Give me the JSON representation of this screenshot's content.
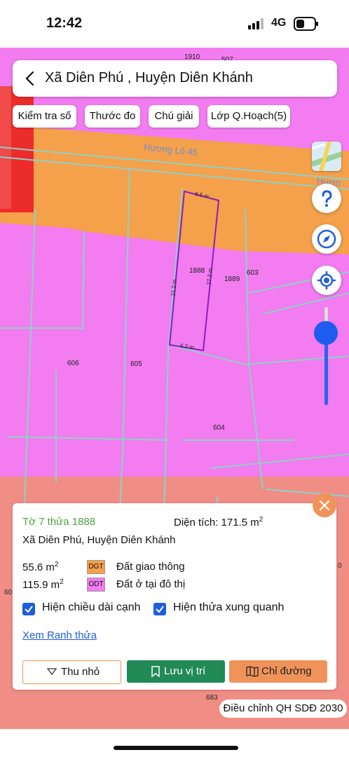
{
  "status_bar": {
    "time": "12:42",
    "network": "4G"
  },
  "header": {
    "title": "Xã Diên Phú , Huyện Diên Khánh"
  },
  "toolbar": {
    "check_number": "Kiểm tra số",
    "ruler": "Thước đo",
    "legend": "Chú giải",
    "planning_layer": "Lớp Q.Hoạch(5)"
  },
  "map": {
    "road_name": "Hương Lộ 45",
    "road_name_right": "Hươn",
    "parcel_labels": [
      "1910",
      "507",
      "1888",
      "1889",
      "603",
      "606",
      "605",
      "604",
      "683",
      "60",
      "0"
    ],
    "dimensions": [
      "6.5 m",
      "27.2 m",
      "21.2 m",
      "6.2 m"
    ],
    "colors": {
      "residential": "#f27cf0",
      "traffic": "#f5a04a",
      "red_zone": "#ee2222",
      "selection": "#8a1fbf",
      "grid_line": "#8fd0c8"
    }
  },
  "panel": {
    "parcel_id": "Tờ 7 thửa 1888",
    "area_label": "Diện tích: 171.5 m",
    "area_sup": "2",
    "location": "Xã Diên Phú, Huyện Diên Khánh",
    "land_uses": [
      {
        "area": "55.6 m",
        "sup": "2",
        "code": "DGT",
        "name": "Đất giao thông",
        "color": "#f5a04a"
      },
      {
        "area": "115.9 m",
        "sup": "2",
        "code": "ODT",
        "name": "Đất ở tại đô thị",
        "color": "#f27cf0"
      }
    ],
    "show_edge_lengths": "Hiện chiều dài cạnh",
    "show_neighbors": "Hiện thửa xung quanh",
    "view_boundary": "Xem Ranh thửa",
    "minimize": "Thu nhỏ",
    "save_location": "Lưu vị trí",
    "directions": "Chỉ đường"
  },
  "plan_badge": "Điều chỉnh QH SDĐ 2030"
}
